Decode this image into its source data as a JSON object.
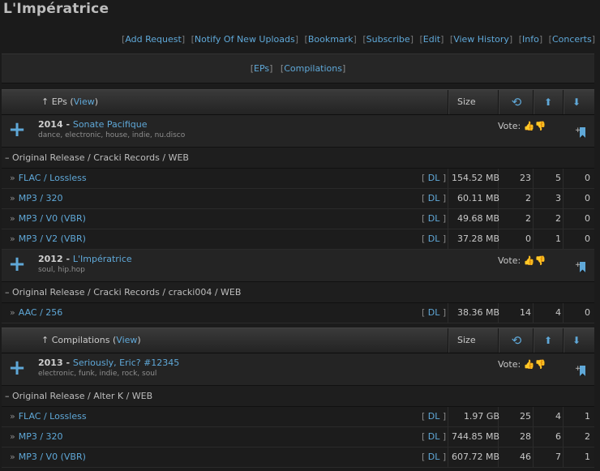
{
  "title": "L'Impératrice",
  "linkbox": [
    "Add Request",
    "Notify Of New Uploads",
    "Bookmark",
    "Subscribe",
    "Edit",
    "View History",
    "Info",
    "Concerts"
  ],
  "nav": [
    "EPs",
    "Compilations"
  ],
  "sections": [
    {
      "arrow": "↑",
      "name": "EPs",
      "view": "View",
      "size_label": "Size",
      "groups": [
        {
          "year": "2014",
          "name": "Sonate Pacifique",
          "tags": "dance, electronic, house, indie, nu.disco",
          "vote": "Vote:",
          "edition": "– Original Release / Cracki Records / WEB",
          "rows": [
            {
              "fmt": "FLAC / Lossless",
              "size": "154.52 MB",
              "snatched": "23",
              "seeders": "5",
              "leechers": "0"
            },
            {
              "fmt": "MP3 / 320",
              "size": "60.11 MB",
              "snatched": "2",
              "seeders": "3",
              "leechers": "0"
            },
            {
              "fmt": "MP3 / V0 (VBR)",
              "size": "49.68 MB",
              "snatched": "2",
              "seeders": "2",
              "leechers": "0"
            },
            {
              "fmt": "MP3 / V2 (VBR)",
              "size": "37.28 MB",
              "snatched": "0",
              "seeders": "1",
              "leechers": "0"
            }
          ]
        },
        {
          "year": "2012",
          "name": "L'Impératrice",
          "tags": "soul, hip.hop",
          "vote": "Vote:",
          "edition": "– Original Release / Cracki Records / cracki004 / WEB",
          "rows": [
            {
              "fmt": "AAC / 256",
              "size": "38.36 MB",
              "snatched": "14",
              "seeders": "4",
              "leechers": "0"
            }
          ]
        }
      ]
    },
    {
      "arrow": "↑",
      "name": "Compilations",
      "view": "View",
      "size_label": "Size",
      "groups": [
        {
          "year": "2013",
          "name": "Seriously, Eric? #12345",
          "tags": "electronic, funk, indie, rock, soul",
          "vote": "Vote:",
          "edition": "– Original Release / Alter K / WEB",
          "rows": [
            {
              "fmt": "FLAC / Lossless",
              "size": "1.97 GB",
              "snatched": "25",
              "seeders": "4",
              "leechers": "1"
            },
            {
              "fmt": "MP3 / 320",
              "size": "744.85 MB",
              "snatched": "28",
              "seeders": "6",
              "leechers": "2"
            },
            {
              "fmt": "MP3 / V0 (VBR)",
              "size": "607.72 MB",
              "snatched": "46",
              "seeders": "7",
              "leechers": "1"
            }
          ]
        }
      ]
    }
  ],
  "row_prefix": "»",
  "dl_label": "DL",
  "colors": {
    "accent": "#5fa8d8",
    "bg": "#1b1b1b",
    "header": "#2e2e2e"
  },
  "icons": {
    "snatched": "refresh-icon",
    "seeders": "arrow-up-icon",
    "leechers": "arrow-down-icon",
    "add": "plus-icon",
    "bookmark": "bookmark-icon",
    "vote_up": "thumb-up-icon",
    "vote_down": "thumb-down-icon"
  }
}
